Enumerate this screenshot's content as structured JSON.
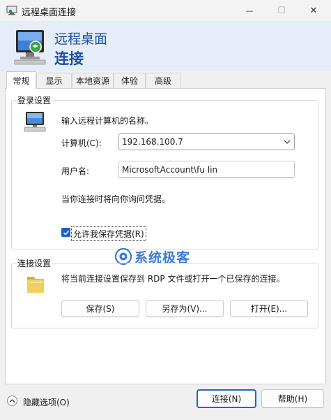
{
  "window": {
    "title": "远程桌面连接",
    "minimize_glyph": "—",
    "maximize_glyph": "☐",
    "close_glyph": "✕"
  },
  "header": {
    "line1": "远程桌面",
    "line2": "连接"
  },
  "tabs": [
    {
      "label": "常规",
      "active": true
    },
    {
      "label": "显示",
      "active": false
    },
    {
      "label": "本地资源",
      "active": false
    },
    {
      "label": "体验",
      "active": false
    },
    {
      "label": "高级",
      "active": false
    }
  ],
  "login": {
    "legend": "登录设置",
    "prompt": "输入远程计算机的名称。",
    "computer_label": "计算机(C):",
    "computer_value": "192.168.100.7",
    "user_label": "用户名:",
    "user_value": "MicrosoftAccount\\fu lin",
    "note": "当你连接时将向你询问凭据。",
    "save_cred_label": "允许我保存凭据(R)",
    "save_cred_checked": true
  },
  "connection": {
    "legend": "连接设置",
    "description": "将当前连接设置保存到 RDP 文件或打开一个已保存的连接。",
    "save_button": "保存(S)",
    "save_as_button": "另存为(V)...",
    "open_button": "打开(E)..."
  },
  "watermark": {
    "text": "系统极客"
  },
  "footer": {
    "hide_options": "隐藏选项(O)",
    "connect_button": "连接(N)",
    "help_button": "帮助(H)"
  },
  "colors": {
    "accent": "#1f5fbf",
    "header_bg": "#e4edf8",
    "header_text": "#1c4f9f",
    "watermark": "#3a7bd5"
  }
}
